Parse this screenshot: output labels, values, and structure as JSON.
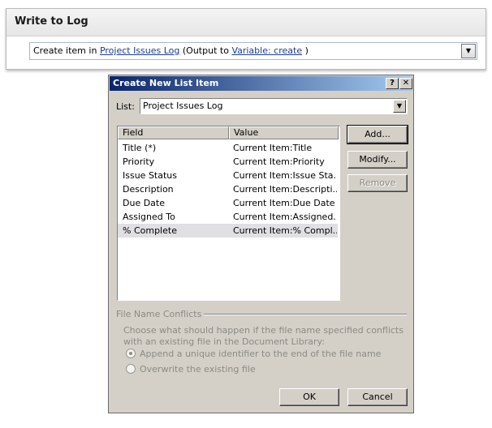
{
  "action": {
    "title": "Write to Log",
    "sentence_prefix": "Create item in",
    "list_link": "Project Issues Log",
    "output_prefix": "(Output to",
    "variable_link": "Variable: create",
    "output_suffix": ")"
  },
  "dialog": {
    "title": "Create New List Item",
    "help_glyph": "?",
    "close_glyph": "✕",
    "list_label": "List:",
    "list_value": "Project Issues Log",
    "columns": {
      "field": "Field",
      "value": "Value"
    },
    "rows": [
      {
        "field": "Title (*)",
        "value": "Current Item:Title"
      },
      {
        "field": "Priority",
        "value": "Current Item:Priority"
      },
      {
        "field": "Issue Status",
        "value": "Current Item:Issue Sta..."
      },
      {
        "field": "Description",
        "value": "Current Item:Descripti..."
      },
      {
        "field": "Due Date",
        "value": "Current Item:Due Date"
      },
      {
        "field": "Assigned To",
        "value": "Current Item:Assigned..."
      },
      {
        "field": "% Complete",
        "value": "Current Item:% Compl..."
      }
    ],
    "selected_row": 6,
    "buttons": {
      "add": "Add...",
      "modify": "Modify...",
      "remove": "Remove",
      "ok": "OK",
      "cancel": "Cancel"
    },
    "conflicts": {
      "label": "File Name Conflicts",
      "description": "Choose what should happen if the file name specified conflicts with an existing file in the Document Library:",
      "option_append": "Append a unique identifier to the end of the file name",
      "option_overwrite": "Overwrite the existing file",
      "selected": "append"
    }
  },
  "colors": {
    "titlebar_start": "#0a246a",
    "titlebar_end": "#a6caf0",
    "dialog_bg": "#d4d0c8",
    "link": "#1c3c8c"
  }
}
